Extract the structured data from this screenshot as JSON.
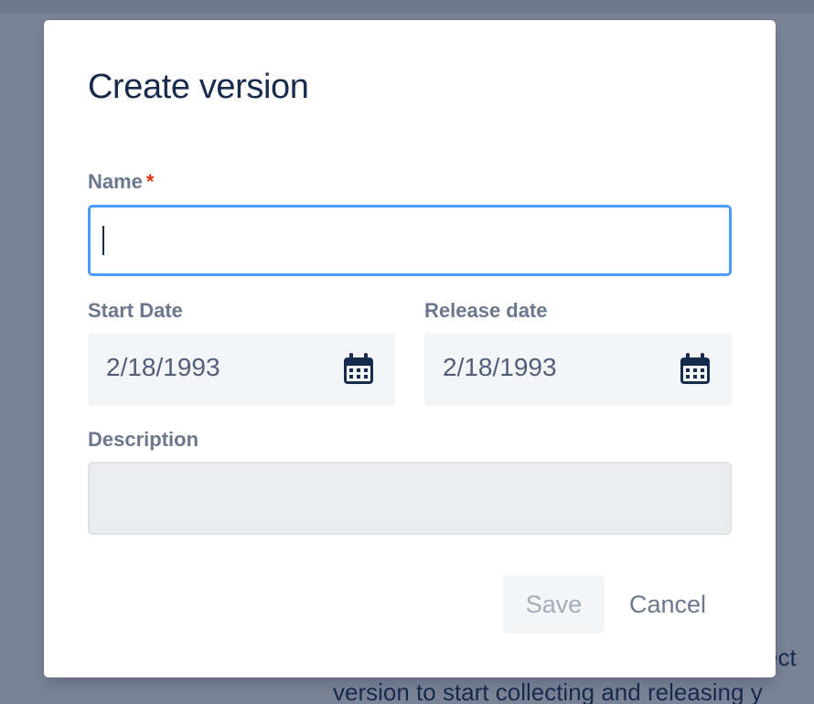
{
  "background": {
    "text_line1": "ect",
    "text_line2": "version to start collecting and releasing y"
  },
  "modal": {
    "title": "Create version",
    "name": {
      "label": "Name",
      "required_marker": "*",
      "value": ""
    },
    "start_date": {
      "label": "Start Date",
      "value": "2/18/1993",
      "icon": "calendar-icon"
    },
    "release_date": {
      "label": "Release date",
      "value": "2/18/1993",
      "icon": "calendar-icon"
    },
    "description": {
      "label": "Description",
      "value": ""
    },
    "buttons": {
      "save_label": "Save",
      "cancel_label": "Cancel"
    }
  },
  "colors": {
    "overlay": "#7a8295",
    "title": "#172b4d",
    "label": "#6b778c",
    "required": "#de350b",
    "focus_border": "#4c9aff",
    "field_bg": "#f4f5f7",
    "disabled_text": "#a5adba"
  }
}
